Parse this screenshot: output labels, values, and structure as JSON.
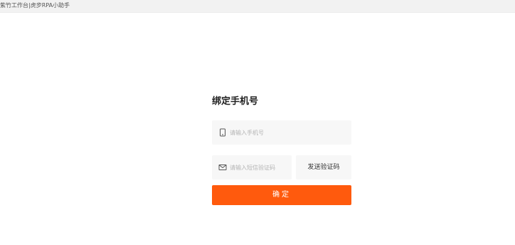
{
  "window": {
    "title": "紫竹工作台|虎步RPA小助手"
  },
  "form": {
    "heading": "绑定手机号",
    "phone": {
      "icon": "phone-icon",
      "placeholder": "请输入手机号",
      "value": ""
    },
    "code": {
      "icon": "mail-icon",
      "placeholder": "请输入短信验证码",
      "value": ""
    },
    "send_code_label": "发送验证码",
    "confirm_label": "确定"
  },
  "colors": {
    "accent": "#ff5a0d",
    "field_bg": "#f7f7f7",
    "titlebar_bg": "#f2f2f2"
  }
}
